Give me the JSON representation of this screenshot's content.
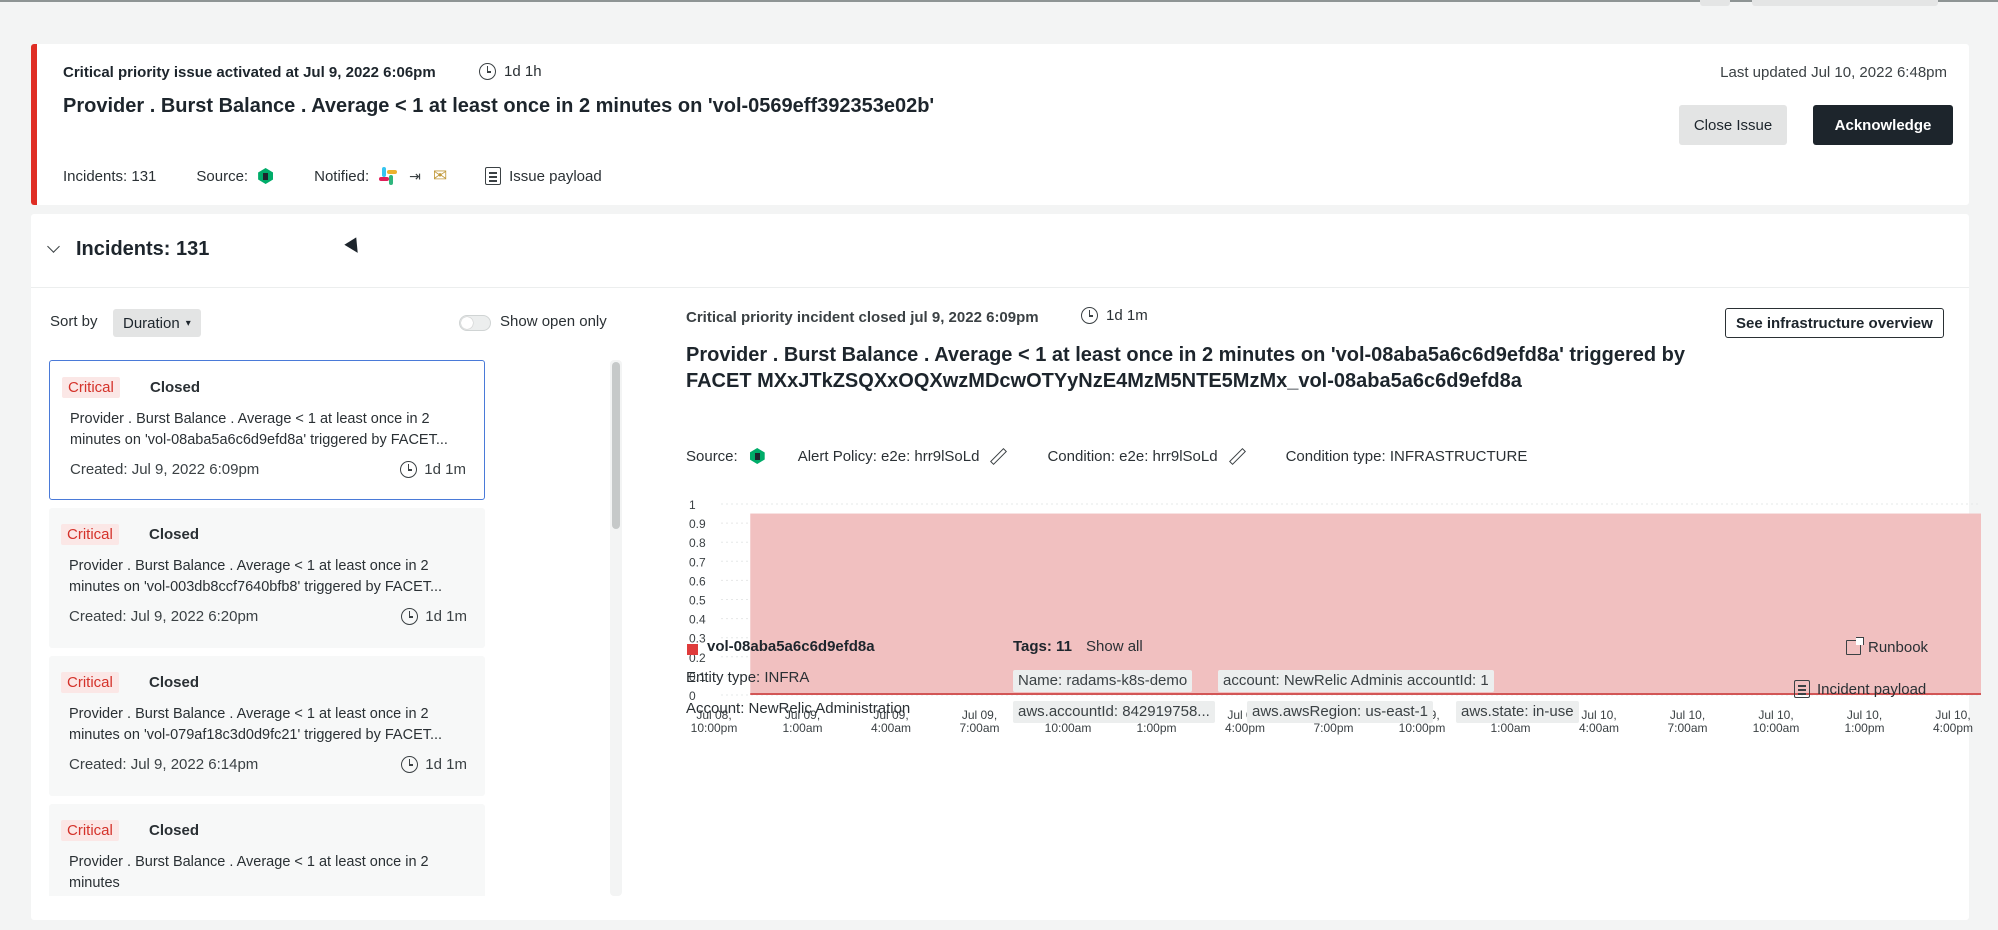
{
  "issue": {
    "activated_text": "Critical priority issue activated at Jul 9, 2022 6:06pm",
    "duration": "1d 1h",
    "title": "Provider . Burst Balance . Average < 1 at least once in 2 minutes on 'vol-0569eff392353e02b'",
    "last_updated": "Last updated Jul 10, 2022 6:48pm",
    "close_label": "Close Issue",
    "ack_label": "Acknowledge",
    "incidents_count": "Incidents: 131",
    "source_label": "Source:",
    "notified_label": "Notified:",
    "payload_label": "Issue payload"
  },
  "incidents_panel": {
    "title": "Incidents: 131",
    "sort_label": "Sort by",
    "sort_value": "Duration",
    "show_open_label": "Show open only",
    "items": [
      {
        "priority": "Critical",
        "status": "Closed",
        "desc": "Provider . Burst Balance . Average < 1 at least once in 2 minutes on 'vol-08aba5a6c6d9efd8a' triggered by FACET...",
        "created": "Created: Jul 9, 2022 6:09pm",
        "duration": "1d 1m"
      },
      {
        "priority": "Critical",
        "status": "Closed",
        "desc": "Provider . Burst Balance . Average < 1 at least once in 2 minutes on 'vol-003db8ccf7640bfb8' triggered by FACET...",
        "created": "Created: Jul 9, 2022 6:20pm",
        "duration": "1d 1m"
      },
      {
        "priority": "Critical",
        "status": "Closed",
        "desc": "Provider . Burst Balance . Average < 1 at least once in 2 minutes on 'vol-079af18c3d0d9fc21' triggered by FACET...",
        "created": "Created: Jul 9, 2022 6:14pm",
        "duration": "1d 1m"
      },
      {
        "priority": "Critical",
        "status": "Closed",
        "desc": "Provider . Burst Balance . Average < 1 at least once in 2 minutes",
        "created": "",
        "duration": ""
      }
    ]
  },
  "detail": {
    "closed_text": "Critical priority incident closed jul 9, 2022 6:09pm",
    "duration": "1d 1m",
    "infra_button": "See infrastructure overview",
    "title": "Provider . Burst Balance . Average < 1 at least once in 2 minutes on 'vol-08aba5a6c6d9efd8a' triggered by FACET MXxJTkZSQXxOQXwzMDcwOTYyNzE4MzM5NTE5MzMx_vol-08aba5a6c6d9efd8a",
    "source_label": "Source:",
    "alert_policy": "Alert Policy: e2e: hrr9lSoLd",
    "condition": "Condition: e2e: hrr9lSoLd",
    "condition_type": "Condition type: INFRASTRUCTURE",
    "entity_name": "vol-08aba5a6c6d9efd8a",
    "entity_type": "Entity type: INFRA",
    "account": "Account: NewRelic Administration",
    "tags_label": "Tags: 11",
    "show_all": "Show all",
    "tags": [
      "Name: radams-k8s-demo",
      "account: NewRelic Adminis...",
      "accountId: 1",
      "aws.accountId: 842919758...",
      "aws.awsRegion: us-east-1",
      "aws.state: in-use"
    ],
    "runbook": "Runbook",
    "incident_payload": "Incident payload"
  },
  "chart_data": {
    "type": "area",
    "title": "",
    "xlabel": "",
    "ylabel": "",
    "y_ticks": [
      "1",
      "0.9",
      "0.8",
      "0.7",
      "0.6",
      "0.5",
      "0.4",
      "0.3",
      "0.2",
      "0.1",
      "0"
    ],
    "x_ticks": [
      [
        "Jul 08,",
        "10:00pm"
      ],
      [
        "Jul 09,",
        "1:00am"
      ],
      [
        "Jul 09,",
        "4:00am"
      ],
      [
        "Jul 09,",
        "7:00am"
      ],
      [
        "Jul 09,",
        "10:00am"
      ],
      [
        "Jul 09,",
        "1:00pm"
      ],
      [
        "Jul 09,",
        "4:00pm"
      ],
      [
        "Jul 09,",
        "7:00pm"
      ],
      [
        "Jul 09,",
        "10:00pm"
      ],
      [
        "Jul 10,",
        "1:00am"
      ],
      [
        "Jul 10,",
        "4:00am"
      ],
      [
        "Jul 10,",
        "7:00am"
      ],
      [
        "Jul 10,",
        "10:00am"
      ],
      [
        "Jul 10,",
        "1:00pm"
      ],
      [
        "Jul 10,",
        "4:00pm"
      ]
    ],
    "ylim": [
      0,
      1
    ],
    "shaded_region": {
      "from_index": 0.5,
      "to_index": 15,
      "value_top": 0.95
    },
    "series": [
      {
        "values": [
          0,
          0,
          0,
          0,
          0,
          0,
          0,
          0,
          0,
          0,
          0,
          0,
          0,
          0,
          0
        ]
      }
    ],
    "colors": {
      "violation": "#f1c0c0",
      "line": "#c83232"
    }
  }
}
